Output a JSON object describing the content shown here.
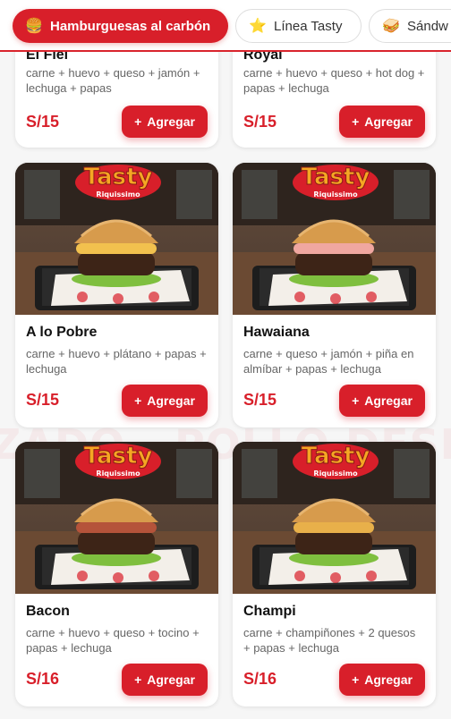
{
  "colors": {
    "accent": "#d81f2a",
    "background": "#f6f6f6"
  },
  "watermarks": [
    "ZADO",
    "POLLO DESMENU"
  ],
  "categories": [
    {
      "label": "Hamburguesas al carbón",
      "icon": "burger-icon",
      "active": true
    },
    {
      "label": "Línea Tasty",
      "icon": "star-icon",
      "active": false
    },
    {
      "label": "Sándw",
      "icon": "sandwich-icon",
      "active": false
    }
  ],
  "products": [
    {
      "name": "El Fiel",
      "desc": "carne + huevo + queso + jamón + lechuga + papas",
      "price": "S/15",
      "add_label": "Agregar"
    },
    {
      "name": "Royal",
      "desc": "carne + huevo + queso + hot dog + papas + lechuga",
      "price": "S/15",
      "add_label": "Agregar"
    },
    {
      "name": "A lo Pobre",
      "desc": "carne + huevo + plátano + papas + lechuga",
      "price": "S/15",
      "add_label": "Agregar",
      "logo_text": "Tasty",
      "logo_sub": "Riquissimo"
    },
    {
      "name": "Hawaiana",
      "desc": "carne + queso + jamón + piña en almíbar + papas + lechuga",
      "price": "S/15",
      "add_label": "Agregar",
      "logo_text": "Tasty",
      "logo_sub": "Riquissimo"
    },
    {
      "name": "Bacon",
      "desc": "carne + huevo + queso + tocino + papas + lechuga",
      "price": "S/16",
      "add_label": "Agregar",
      "logo_text": "Tasty",
      "logo_sub": "Riquissimo"
    },
    {
      "name": "Champi",
      "desc": "carne + champiñones + 2 quesos + papas + lechuga",
      "price": "S/16",
      "add_label": "Agregar",
      "logo_text": "Tasty",
      "logo_sub": "Riquissimo"
    }
  ]
}
